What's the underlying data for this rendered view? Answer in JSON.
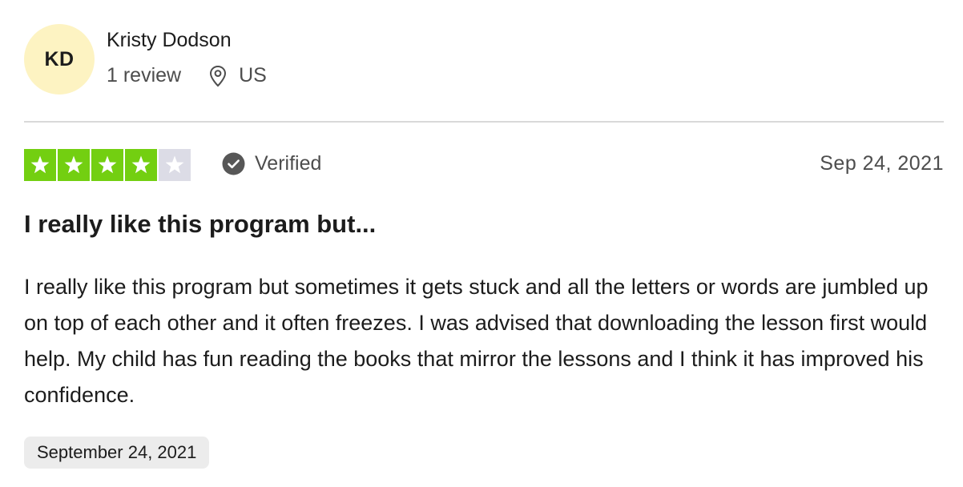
{
  "reviewer": {
    "initials": "KD",
    "name": "Kristy Dodson",
    "review_count": "1 review",
    "location": "US",
    "avatar_color": "#fdf3c2"
  },
  "review": {
    "rating": 4,
    "max_rating": 5,
    "star_color": "#73cf11",
    "empty_star_color": "#dcdce6",
    "verified_label": "Verified",
    "date": "Sep 24, 2021",
    "title": "I really like this program but...",
    "body": "I really like this program but sometimes it gets stuck and all the letters or words are jumbled up on top of each other and it often freezes. I was advised that downloading the lesson first would help. My child has fun reading the books that mirror the lessons and I think it has improved his confidence.",
    "experience_date": "September 24, 2021"
  },
  "icons": {
    "location": "location-pin-icon",
    "verified": "check-circle-icon",
    "star": "star-icon"
  }
}
